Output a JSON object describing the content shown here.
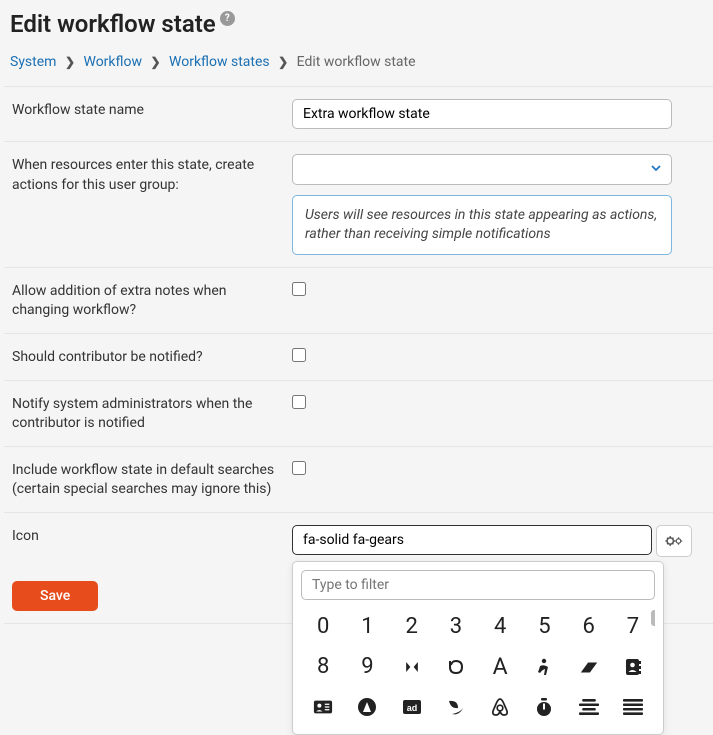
{
  "page": {
    "title": "Edit workflow state"
  },
  "breadcrumb": {
    "items": [
      "System",
      "Workflow",
      "Workflow states"
    ],
    "current": "Edit workflow state"
  },
  "form": {
    "name": {
      "label": "Workflow state name",
      "value": "Extra workflow state"
    },
    "userGroup": {
      "label": "When resources enter this state, create actions for this user group:",
      "hint": "Users will see resources in this state appearing as actions, rather than receiving simple notifications"
    },
    "allowNotes": {
      "label": "Allow addition of extra notes when changing workflow?",
      "checked": false
    },
    "notifyContributor": {
      "label": "Should contributor be notified?",
      "checked": false
    },
    "notifyAdmins": {
      "label": "Notify system administrators when the contributor is notified",
      "checked": false
    },
    "includeDefault": {
      "label": "Include workflow state in default searches (certain special searches may ignore this)",
      "checked": false
    },
    "icon": {
      "label": "Icon",
      "value": "fa-solid fa-gears"
    }
  },
  "iconPicker": {
    "filterPlaceholder": "Type to filter",
    "digits": [
      "0",
      "1",
      "2",
      "3",
      "4",
      "5",
      "6",
      "7",
      "8",
      "9"
    ]
  },
  "actions": {
    "save": "Save"
  }
}
